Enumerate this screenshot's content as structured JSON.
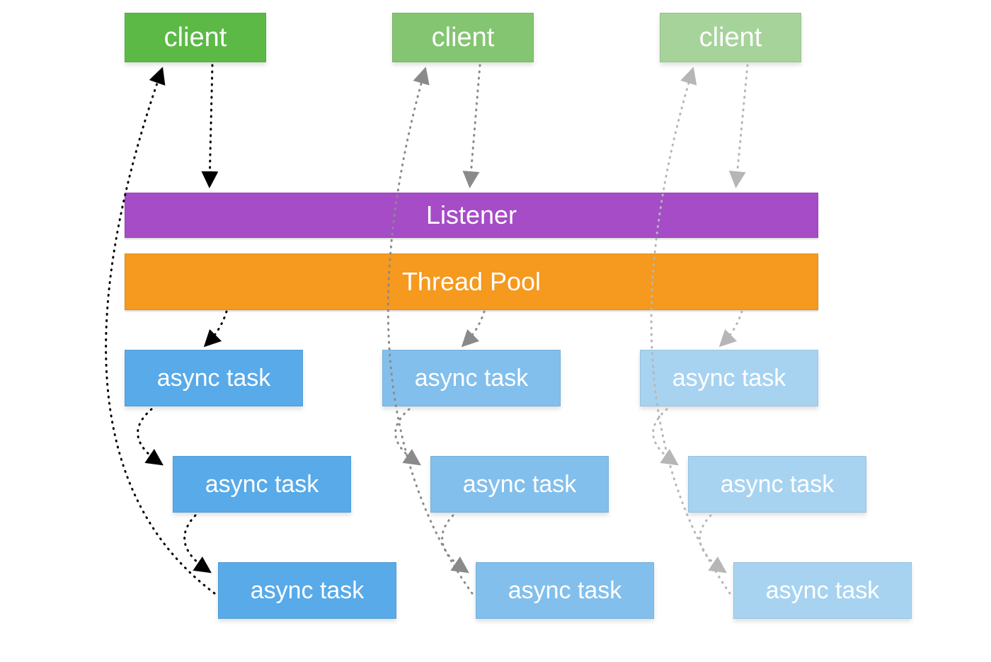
{
  "clients": [
    {
      "label": "client"
    },
    {
      "label": "client"
    },
    {
      "label": "client"
    }
  ],
  "listener": {
    "label": "Listener"
  },
  "thread_pool": {
    "label": "Thread Pool"
  },
  "columns": [
    {
      "tasks": [
        "async task",
        "async task",
        "async task"
      ]
    },
    {
      "tasks": [
        "async task",
        "async task",
        "async task"
      ]
    },
    {
      "tasks": [
        "async task",
        "async task",
        "async task"
      ]
    }
  ],
  "arrow_colors": {
    "col1": "#000000",
    "col2": "#8a8a8a",
    "col3": "#b6b6b6"
  }
}
